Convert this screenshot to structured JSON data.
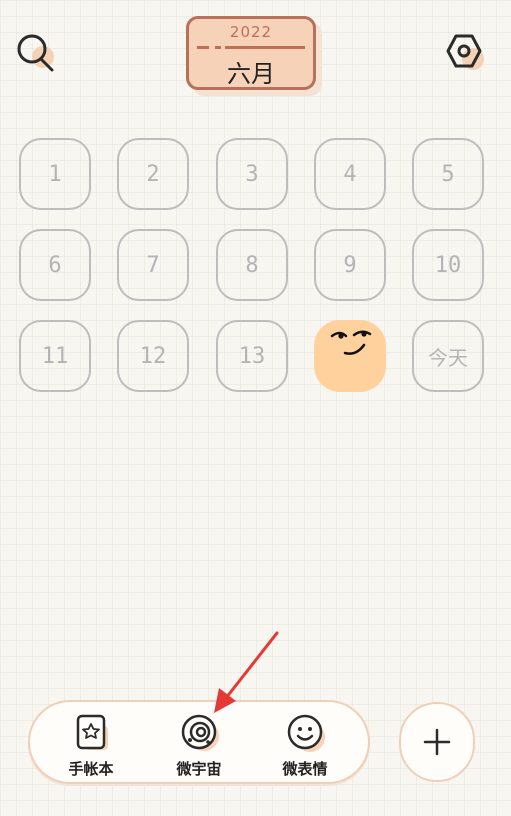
{
  "header": {
    "year": "2022",
    "month": "六月",
    "search_icon": "search-icon",
    "settings_icon": "settings-icon"
  },
  "calendar": {
    "days": [
      "1",
      "2",
      "3",
      "4",
      "5",
      "6",
      "7",
      "8",
      "9",
      "10",
      "11",
      "12",
      "13"
    ],
    "today_label": "今天",
    "day14_icon": "smirk-face-icon"
  },
  "tabbar": {
    "tabs": [
      {
        "label": "手帐本",
        "icon": "notebook-icon"
      },
      {
        "label": "微宇宙",
        "icon": "planet-icon"
      },
      {
        "label": "微表情",
        "icon": "smile-face-icon"
      }
    ],
    "add_icon": "plus-icon"
  },
  "colors": {
    "accent": "#b7705a",
    "peach": "#f6d2b8",
    "emoji_bg": "#ffd29d",
    "annotation_arrow": "#e53935"
  }
}
